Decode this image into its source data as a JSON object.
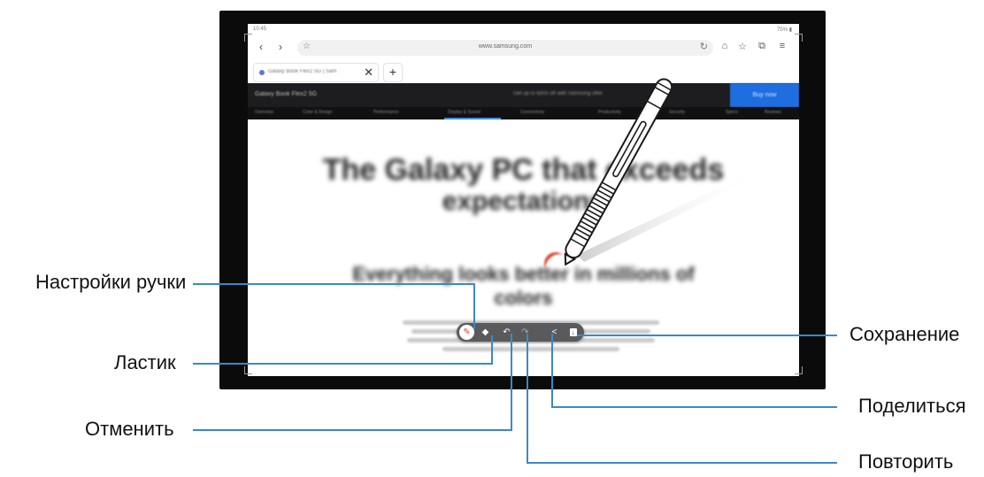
{
  "statusbar": {
    "time": "10:45",
    "right": "75% ▮"
  },
  "browser": {
    "url": "www.samsung.com",
    "tab_title": "Galaxy Book Flex2 5G | Sam",
    "tab_close": "✕",
    "new_tab": "+",
    "back_icon": "‹",
    "forward_icon": "›"
  },
  "site": {
    "title": "Galaxy Book Flex2 5G",
    "promo": "Get up to $300 off with Samsung offer",
    "cta": "Buy now",
    "nav": [
      "Overview",
      "Color & Design",
      "Performance",
      "Display & Sound",
      "Connectivity",
      "Productivity",
      "Security",
      "Specs",
      "Reviews"
    ]
  },
  "page": {
    "hero_line1": "The Galaxy PC that exceeds",
    "hero_line2": "expectations",
    "sub_line1": "Everything looks better in millions of",
    "sub_line2": "colors"
  },
  "toolbar": {
    "pen": "✎",
    "eraser": "◆",
    "undo": "↶",
    "redo": "↷",
    "share": "<",
    "save": "↓"
  },
  "callouts": {
    "pen_settings": "Настройки ручки",
    "eraser": "Ластик",
    "undo": "Отменить",
    "save": "Сохранение",
    "share": "Поделиться",
    "redo": "Повторить"
  },
  "colors": {
    "callout_line": "#3b89c7",
    "toolbar_bg": "#5a5a5c",
    "accent": "#1f6ee0"
  }
}
